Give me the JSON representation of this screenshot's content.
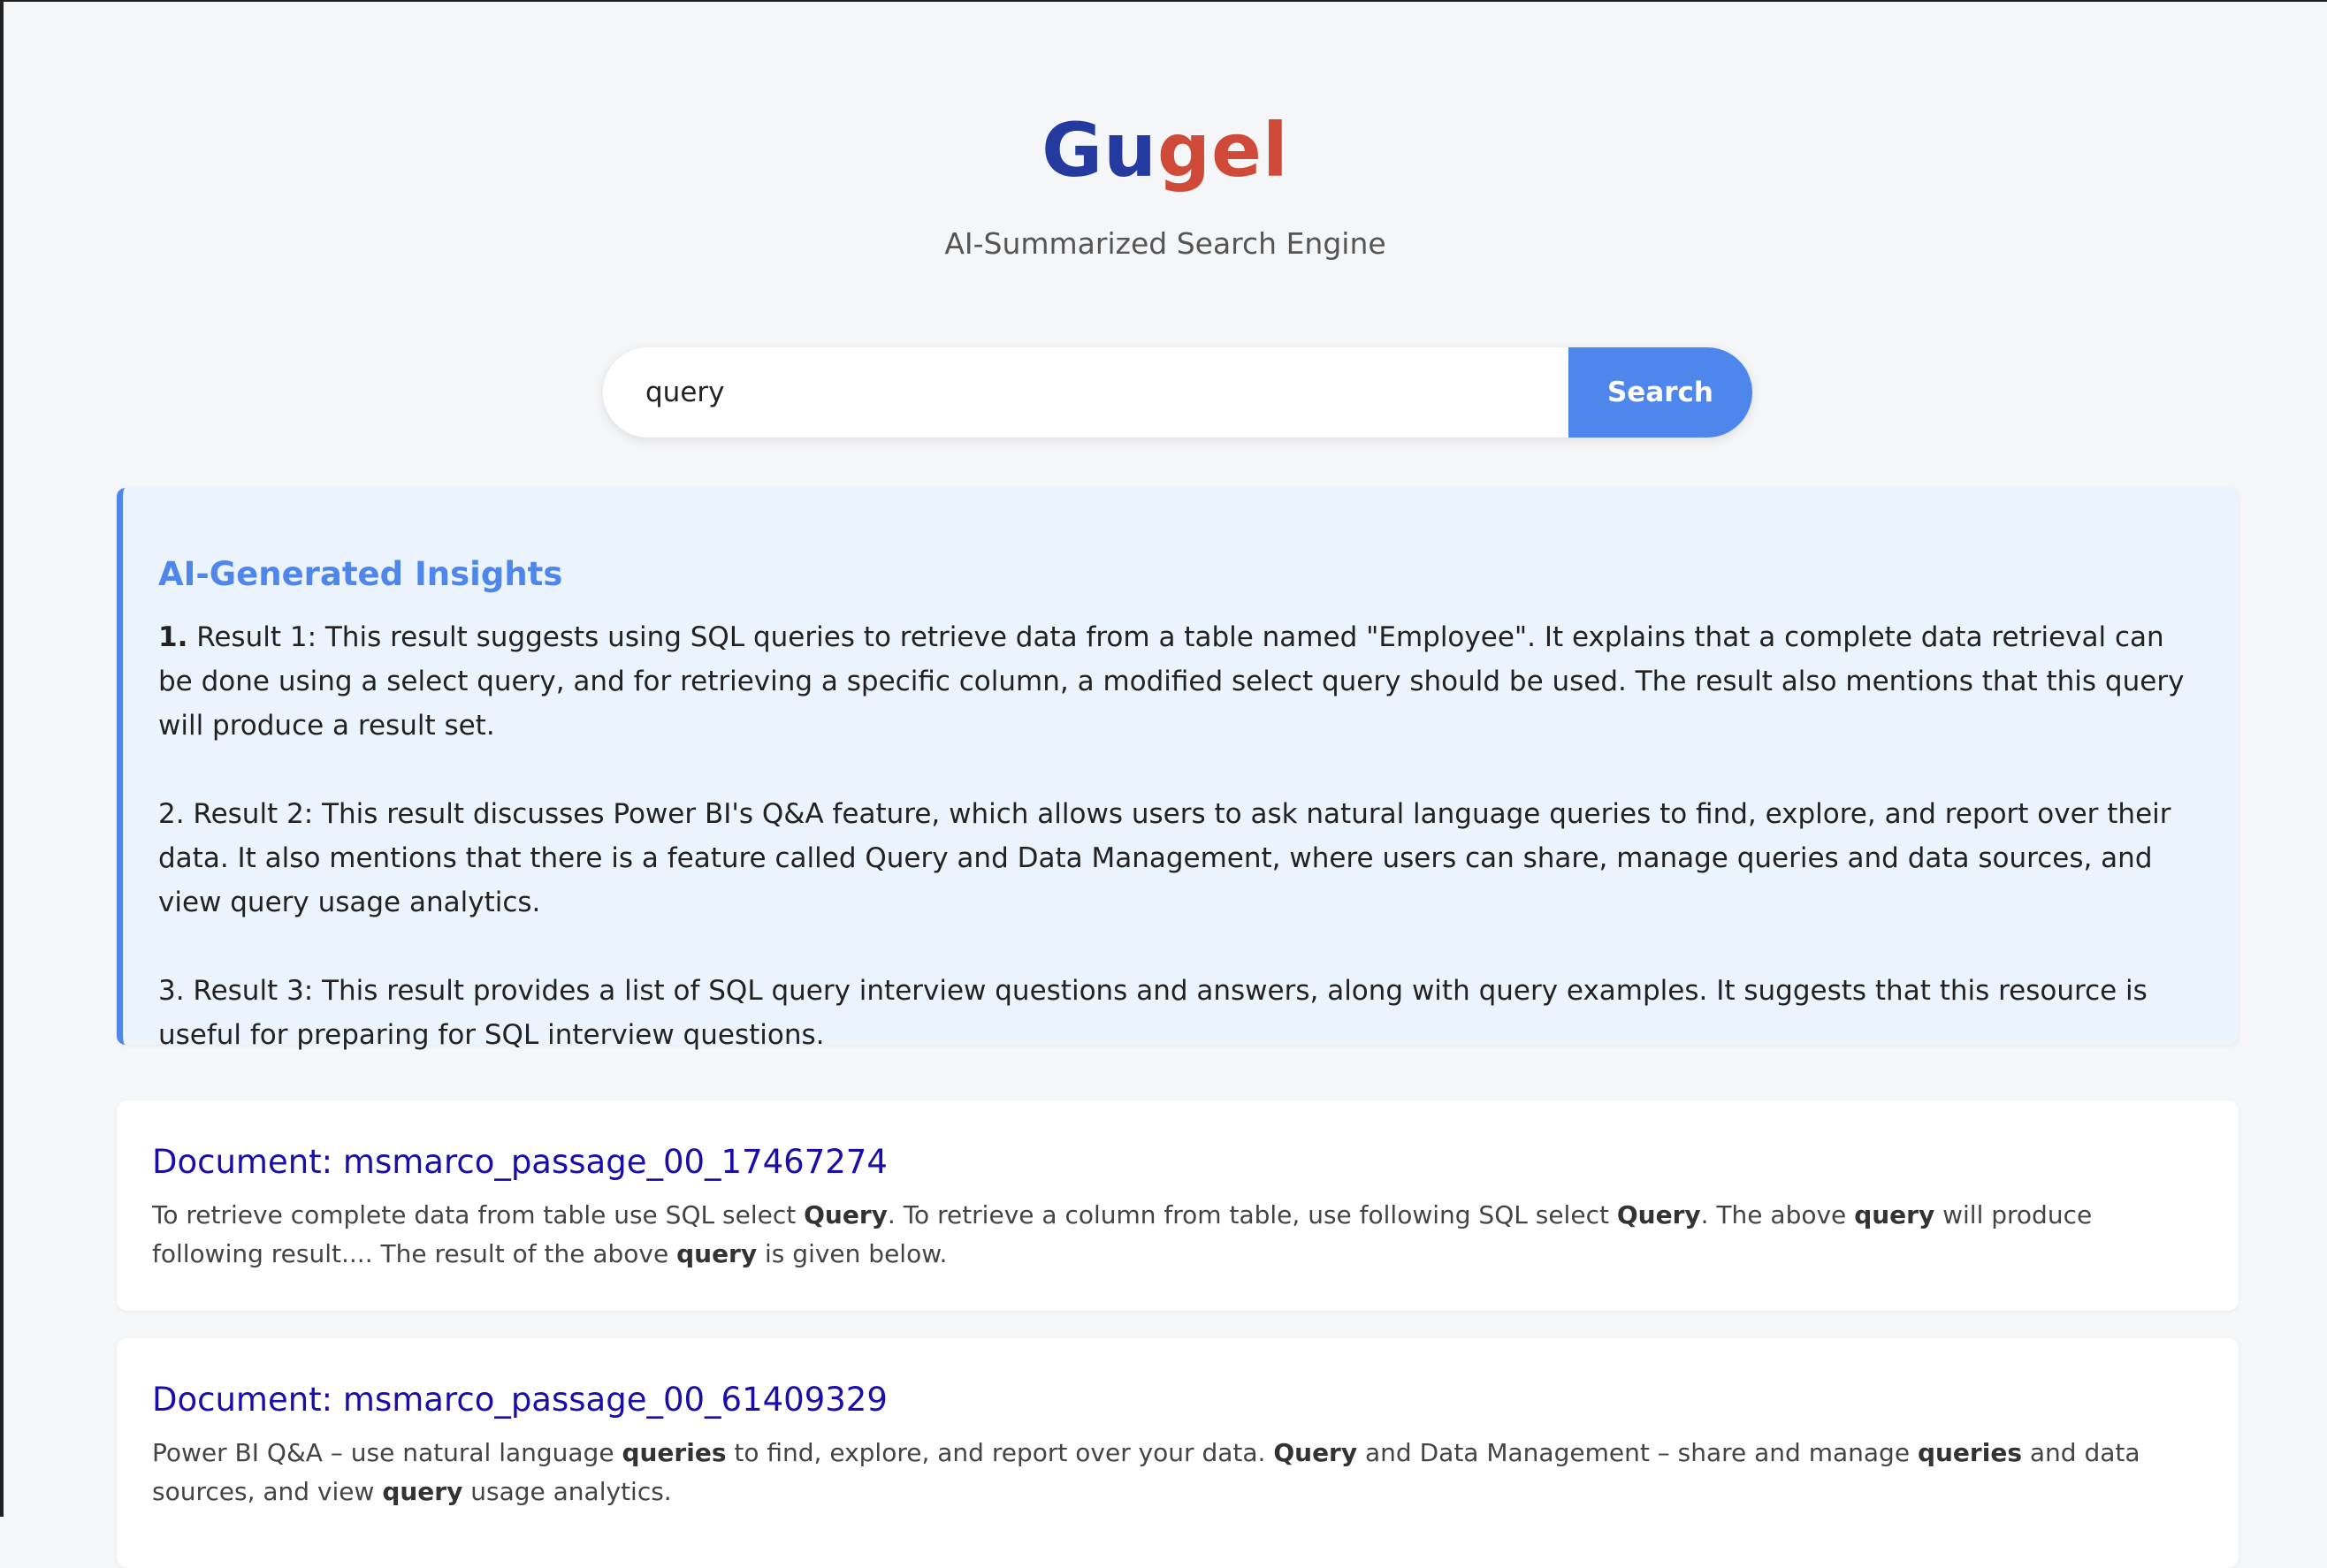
{
  "header": {
    "logo_part1": "Gu",
    "logo_part2": "gel",
    "tagline": "AI-Summarized Search Engine"
  },
  "search": {
    "query": "query",
    "button_label": "Search"
  },
  "insights": {
    "title": "AI-Generated Insights",
    "items": [
      {
        "number": "1.",
        "text": " Result 1: This result suggests using SQL queries to retrieve data from a table named \"Employee\". It explains that a complete data retrieval can be done using a select query, and for retrieving a specific column, a modified select query should be used. The result also mentions that this query will produce a result set."
      },
      {
        "number": "",
        "text": "2. Result 2: This result discusses Power BI's Q&A feature, which allows users to ask natural language queries to find, explore, and report over their data. It also mentions that there is a feature called Query and Data Management, where users can share, manage queries and data sources, and view query usage analytics."
      },
      {
        "number": "",
        "text": "3. Result 3: This result provides a list of SQL query interview questions and answers, along with query examples. It suggests that this resource is useful for preparing for SQL interview questions."
      }
    ]
  },
  "results": [
    {
      "title": "Document: msmarco_passage_00_17467274",
      "snippet": [
        {
          "text": "To retrieve complete data from table use SQL select ",
          "bold": false
        },
        {
          "text": "Query",
          "bold": true
        },
        {
          "text": ". To retrieve a column from table, use following SQL select ",
          "bold": false
        },
        {
          "text": "Query",
          "bold": true
        },
        {
          "text": ". The above ",
          "bold": false
        },
        {
          "text": "query",
          "bold": true
        },
        {
          "text": " will produce following result.... The result of the above ",
          "bold": false
        },
        {
          "text": "query",
          "bold": true
        },
        {
          "text": " is given below.",
          "bold": false
        }
      ]
    },
    {
      "title": "Document: msmarco_passage_00_61409329",
      "snippet": [
        {
          "text": "Power BI Q&A – use natural language ",
          "bold": false
        },
        {
          "text": "queries",
          "bold": true
        },
        {
          "text": " to find, explore, and report over your data. ",
          "bold": false
        },
        {
          "text": "Query",
          "bold": true
        },
        {
          "text": " and Data Management – share and manage ",
          "bold": false
        },
        {
          "text": "queries",
          "bold": true
        },
        {
          "text": " and data sources, and view ",
          "bold": false
        },
        {
          "text": "query",
          "bold": true
        },
        {
          "text": " usage analytics.",
          "bold": false
        }
      ]
    }
  ],
  "colors": {
    "logo_blue": "#253a9e",
    "logo_red": "#d04a3a",
    "accent": "#4f86ec",
    "link": "#1a0dab",
    "insights_background": "#ebf3fd",
    "page_background": "#f5f6f8"
  }
}
